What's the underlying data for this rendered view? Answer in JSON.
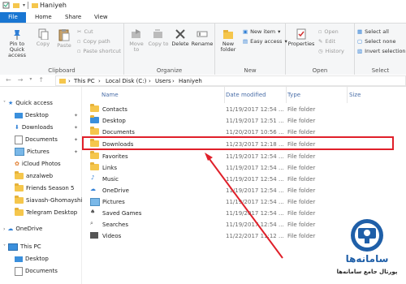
{
  "window": {
    "title": "Haniyeh",
    "tabs": [
      {
        "label": "File"
      },
      {
        "label": "Home"
      },
      {
        "label": "Share"
      },
      {
        "label": "View"
      }
    ]
  },
  "ribbon": {
    "clipboard": {
      "label": "Clipboard",
      "pin_label": "Pin to Quick access",
      "copy_label": "Copy",
      "paste_label": "Paste",
      "cut_label": "Cut",
      "copy_path_label": "Copy path",
      "paste_shortcut_label": "Paste shortcut"
    },
    "organize": {
      "label": "Organize",
      "move_to_label": "Move to",
      "copy_to_label": "Copy to",
      "delete_label": "Delete",
      "rename_label": "Rename"
    },
    "new": {
      "label": "New",
      "new_folder_label": "New folder",
      "new_item_label": "New item",
      "easy_access_label": "Easy access"
    },
    "open": {
      "label": "Open",
      "properties_label": "Properties",
      "open_label": "Open",
      "edit_label": "Edit",
      "history_label": "History"
    },
    "select": {
      "label": "Select",
      "select_all_label": "Select all",
      "select_none_label": "Select none",
      "invert_label": "Invert selection"
    }
  },
  "address": {
    "crumbs": [
      "This PC",
      "Local Disk (C:)",
      "Users",
      "Haniyeh"
    ]
  },
  "nav": {
    "quick_access": "Quick access",
    "items": [
      "Desktop",
      "Downloads",
      "Documents",
      "Pictures",
      "iCloud Photos",
      "anzalweb",
      "Friends Season 5",
      "Siavash-Ghomayshi",
      "Telegram Desktop"
    ],
    "onedrive": "OneDrive",
    "this_pc": "This PC",
    "pc_items": [
      "Desktop",
      "Documents"
    ]
  },
  "columns": {
    "name": "Name",
    "date": "Date modified",
    "type": "Type",
    "size": "Size"
  },
  "rows": [
    {
      "name": "Contacts",
      "date": "11/19/2017 12:54 ...",
      "type": "File folder"
    },
    {
      "name": "Desktop",
      "date": "11/19/2017 12:51 ...",
      "type": "File folder"
    },
    {
      "name": "Documents",
      "date": "11/20/2017 10:56 ...",
      "type": "File folder"
    },
    {
      "name": "Downloads",
      "date": "11/23/2017 12:18 ...",
      "type": "File folder"
    },
    {
      "name": "Favorites",
      "date": "11/19/2017 12:54 ...",
      "type": "File folder"
    },
    {
      "name": "Links",
      "date": "11/19/2017 12:54 ...",
      "type": "File folder"
    },
    {
      "name": "Music",
      "date": "11/19/2017 12:54 ...",
      "type": "File folder"
    },
    {
      "name": "OneDrive",
      "date": "11/19/2017 12:54 ...",
      "type": "File folder"
    },
    {
      "name": "Pictures",
      "date": "11/19/2017 12:54 ...",
      "type": "File folder"
    },
    {
      "name": "Saved Games",
      "date": "11/19/2017 12:54 ...",
      "type": "File folder"
    },
    {
      "name": "Searches",
      "date": "11/19/2017 12:54 ...",
      "type": "File folder"
    },
    {
      "name": "Videos",
      "date": "11/22/2017 11:12 ...",
      "type": "File folder"
    }
  ],
  "logo": {
    "line1": "سامانه‌ها",
    "line2": "پورتال جامع سامانه‌ها"
  },
  "colors": {
    "accent": "#1976d2",
    "highlight": "#e0202a",
    "logo": "#1f5fa8"
  }
}
